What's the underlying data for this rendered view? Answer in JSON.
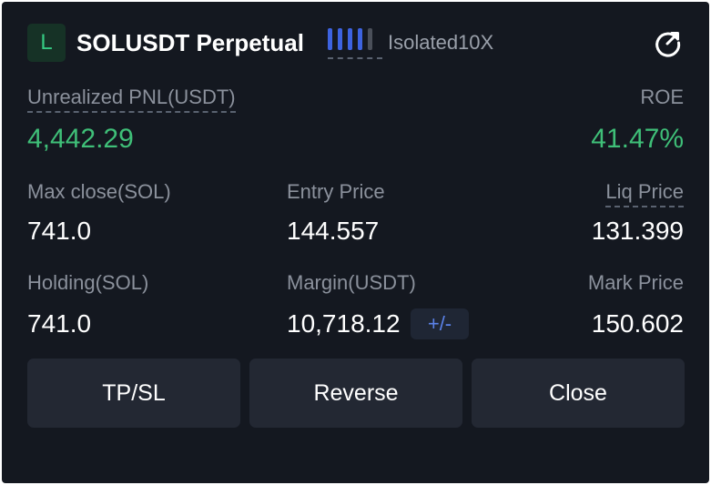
{
  "position": {
    "side": "L",
    "symbol": "SOLUSDT Perpetual",
    "margin_mode": "Isolated10X",
    "leverage_level": 4,
    "leverage_max": 5,
    "leverage_colors": {
      "active": "#3d63e0",
      "inactive": "#4a4f59"
    }
  },
  "pnl": {
    "label": "Unrealized PNL(USDT)",
    "value": "4,442.29",
    "roe_label": "ROE",
    "roe_value": "41.47%",
    "color": "#3fbf78"
  },
  "stats": {
    "max_close_label": "Max close(SOL)",
    "max_close_value": "741.0",
    "entry_price_label": "Entry Price",
    "entry_price_value": "144.557",
    "liq_price_label": "Liq Price",
    "liq_price_value": "131.399",
    "holding_label": "Holding(SOL)",
    "holding_value": "741.0",
    "margin_label": "Margin(USDT)",
    "margin_value": "10,718.12",
    "adjust_margin_label": "+/-",
    "mark_price_label": "Mark Price",
    "mark_price_value": "150.602"
  },
  "actions": {
    "tpsl_label": "TP/SL",
    "reverse_label": "Reverse",
    "close_label": "Close"
  },
  "icons": {
    "share": "share-icon"
  }
}
